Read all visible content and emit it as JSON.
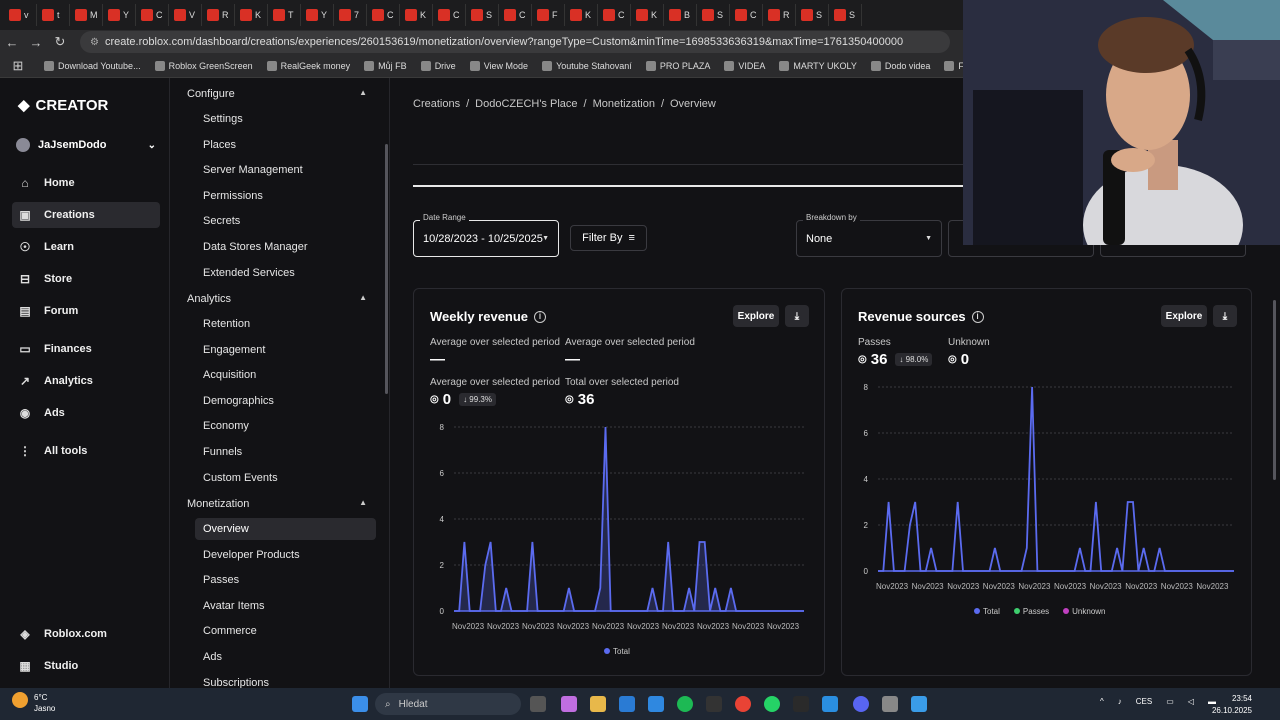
{
  "tabs": [
    {
      "label": "v"
    },
    {
      "label": "t"
    },
    {
      "label": "M"
    },
    {
      "label": "Y"
    },
    {
      "label": "C"
    },
    {
      "label": "V"
    },
    {
      "label": "R"
    },
    {
      "label": "K"
    },
    {
      "label": "T"
    },
    {
      "label": "Y"
    },
    {
      "label": "7"
    },
    {
      "label": "C"
    },
    {
      "label": "K"
    },
    {
      "label": "C"
    },
    {
      "label": "S"
    },
    {
      "label": "C"
    },
    {
      "label": "F"
    },
    {
      "label": "K"
    },
    {
      "label": "C"
    },
    {
      "label": "K"
    },
    {
      "label": "B"
    },
    {
      "label": "S"
    },
    {
      "label": "C"
    },
    {
      "label": "R"
    },
    {
      "label": "S"
    },
    {
      "label": "S"
    }
  ],
  "address": {
    "url": "create.roblox.com/dashboard/creations/experiences/260153619/monetization/overview?rangeType=Custom&minTime=1698533636319&maxTime=1761350400000"
  },
  "bookmarks": [
    {
      "label": "Download Youtube..."
    },
    {
      "label": "Roblox GreenScreen"
    },
    {
      "label": "RealGeek money"
    },
    {
      "label": "Můj FB"
    },
    {
      "label": "Drive"
    },
    {
      "label": "View Mode"
    },
    {
      "label": "Youtube Stahovaní"
    },
    {
      "label": "PRO PLAZA"
    },
    {
      "label": "VIDEA"
    },
    {
      "label": "MARTY UKOLY"
    },
    {
      "label": "Dodo videa"
    },
    {
      "label": "FN"
    }
  ],
  "leftnav": {
    "logo": "CREATOR",
    "user": "JaJsemDodo",
    "items": [
      {
        "label": "Home",
        "icon": "home-icon"
      },
      {
        "label": "Creations",
        "icon": "creations-icon"
      },
      {
        "label": "Learn",
        "icon": "learn-icon"
      },
      {
        "label": "Store",
        "icon": "store-icon"
      },
      {
        "label": "Forum",
        "icon": "forum-icon"
      },
      {
        "label": "Finances",
        "icon": "finances-icon"
      },
      {
        "label": "Analytics",
        "icon": "analytics-icon"
      },
      {
        "label": "Ads",
        "icon": "ads-icon"
      },
      {
        "label": "All tools",
        "icon": "all-tools-icon"
      },
      {
        "label": "Roblox.com",
        "icon": "roblox-icon"
      },
      {
        "label": "Studio",
        "icon": "studio-icon"
      }
    ]
  },
  "subnav": {
    "configure": "Configure",
    "configure_items": [
      "Settings",
      "Places",
      "Server Management",
      "Permissions",
      "Secrets",
      "Data Stores Manager",
      "Extended Services"
    ],
    "analytics": "Analytics",
    "analytics_items": [
      "Retention",
      "Engagement",
      "Acquisition",
      "Demographics",
      "Economy",
      "Funnels",
      "Custom Events"
    ],
    "monetization": "Monetization",
    "monetization_items": [
      "Overview",
      "Developer Products",
      "Passes",
      "Avatar Items",
      "Commerce",
      "Ads",
      "Subscriptions"
    ]
  },
  "breadcrumb": {
    "c1": "Creations",
    "c2": "DodoCZECH's Place",
    "c3": "Monetization",
    "c4": "Overview",
    "sep": "/"
  },
  "filters": {
    "date_label": "Date Range",
    "date_value": "10/28/2023 - 10/25/2025",
    "filter_by": "Filter By",
    "breakdown_label": "Breakdown by",
    "breakdown_value": "None"
  },
  "weekly": {
    "title": "Weekly revenue",
    "explore": "Explore",
    "avg1_label": "Average over selected period",
    "avg1_value": "—",
    "avg2_label": "Average over selected period",
    "avg2_value": "—",
    "avg3_label": "Average over selected period",
    "avg3_value": "0",
    "avg3_change": "↓ 99.3%",
    "total_label": "Total over selected period",
    "total_value": "36",
    "legend_total": "Total"
  },
  "sources": {
    "title": "Revenue sources",
    "explore": "Explore",
    "passes_label": "Passes",
    "passes_value": "36",
    "passes_change": "↓ 98.0%",
    "unknown_label": "Unknown",
    "unknown_value": "0",
    "legend_total": "Total",
    "legend_passes": "Passes",
    "legend_unknown": "Unknown"
  },
  "chart_data": [
    {
      "type": "area",
      "title": "Weekly revenue",
      "ylim": [
        0,
        8
      ],
      "yticks": [
        "0",
        "2",
        "4",
        "6",
        "8"
      ],
      "series": [
        {
          "name": "Total",
          "color": "#5b6bf0",
          "values": [
            0,
            0,
            3,
            0,
            0,
            0,
            2,
            3,
            0,
            0,
            1,
            0,
            0,
            0,
            0,
            3,
            0,
            0,
            0,
            0,
            0,
            0,
            1,
            0,
            0,
            0,
            0,
            0,
            1,
            8,
            0,
            0,
            0,
            0,
            0,
            0,
            0,
            0,
            1,
            0,
            0,
            3,
            0,
            0,
            0,
            1,
            0,
            3,
            3,
            0,
            1,
            0,
            0,
            1,
            0,
            0,
            0,
            0,
            0,
            0,
            0,
            0,
            0,
            0,
            0,
            0,
            0,
            0
          ]
        }
      ],
      "x_label_text": "Nov2023"
    },
    {
      "type": "line",
      "title": "Revenue sources",
      "ylim": [
        0,
        8
      ],
      "yticks": [
        "0",
        "2",
        "4",
        "6",
        "8"
      ],
      "series": [
        {
          "name": "Total",
          "color": "#5b6bf0",
          "values": [
            0,
            0,
            3,
            0,
            0,
            0,
            2,
            3,
            0,
            0,
            1,
            0,
            0,
            0,
            0,
            3,
            0,
            0,
            0,
            0,
            0,
            0,
            1,
            0,
            0,
            0,
            0,
            0,
            1,
            8,
            0,
            0,
            0,
            0,
            0,
            0,
            0,
            0,
            1,
            0,
            0,
            3,
            0,
            0,
            0,
            1,
            0,
            3,
            3,
            0,
            1,
            0,
            0,
            1,
            0,
            0,
            0,
            0,
            0,
            0,
            0,
            0,
            0,
            0,
            0,
            0,
            0,
            0
          ]
        },
        {
          "name": "Passes",
          "color": "#3ecf6e",
          "values": []
        },
        {
          "name": "Unknown",
          "color": "#c040c0",
          "values": []
        }
      ],
      "x_label_text": "Nov2023"
    }
  ],
  "taskbar": {
    "temp": "6°C",
    "weather": "Jasno",
    "search": "Hledat",
    "lang": "CES",
    "time": "23:54",
    "date": "26.10.2025"
  }
}
